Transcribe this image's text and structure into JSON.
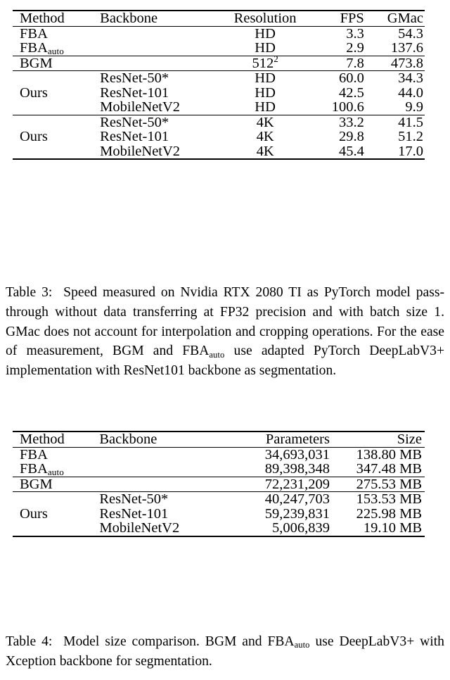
{
  "table3": {
    "columns": [
      "Method",
      "Backbone",
      "Resolution",
      "FPS",
      "GMac"
    ],
    "groups": [
      {
        "rows": [
          {
            "method": "FBA",
            "method_sub": "",
            "backbone": "",
            "resolution": "HD",
            "fps": "3.3",
            "gmac": "54.3"
          },
          {
            "method": "FBA",
            "method_sub": "auto",
            "backbone": "",
            "resolution": "HD",
            "fps": "2.9",
            "gmac": "137.6"
          }
        ]
      },
      {
        "rows": [
          {
            "method": "BGM",
            "method_sub": "",
            "backbone": "",
            "resolution": "512",
            "resolution_sup": "2",
            "fps": "7.8",
            "gmac": "473.8"
          }
        ]
      },
      {
        "group_label": "Ours",
        "rows": [
          {
            "backbone": "ResNet-50*",
            "resolution": "HD",
            "fps": "60.0",
            "gmac": "34.3"
          },
          {
            "backbone": "ResNet-101",
            "resolution": "HD",
            "fps": "42.5",
            "gmac": "44.0"
          },
          {
            "backbone": "MobileNetV2",
            "resolution": "HD",
            "fps": "100.6",
            "gmac": "9.9"
          }
        ]
      },
      {
        "group_label": "Ours",
        "rows": [
          {
            "backbone": "ResNet-50*",
            "resolution": "4K",
            "fps": "33.2",
            "gmac": "41.5"
          },
          {
            "backbone": "ResNet-101",
            "resolution": "4K",
            "fps": "29.8",
            "gmac": "51.2"
          },
          {
            "backbone": "MobileNetV2",
            "resolution": "4K",
            "fps": "45.4",
            "gmac": "17.0"
          }
        ]
      }
    ]
  },
  "caption3": {
    "label": "Table 3:",
    "part1": "Speed measured on Nvidia RTX 2080 TI as PyTorch model pass-through without data transferring at FP32 precision and with batch size 1. GMac does not account for interpolation and cropping operations. For the ease of measurement, BGM and FBA",
    "sub": "auto",
    "part2": "use adapted PyTorch DeepLabV3+ implementation with ResNet101 backbone as segmentation."
  },
  "table4": {
    "columns": [
      "Method",
      "Backbone",
      "Parameters",
      "Size"
    ],
    "groups": [
      {
        "rows": [
          {
            "method": "FBA",
            "method_sub": "",
            "backbone": "",
            "parameters": "34,693,031",
            "size": "138.80 MB"
          },
          {
            "method": "FBA",
            "method_sub": "auto",
            "backbone": "",
            "parameters": "89,398,348",
            "size": "347.48 MB"
          }
        ]
      },
      {
        "rows": [
          {
            "method": "BGM",
            "method_sub": "",
            "backbone": "",
            "parameters": "72,231,209",
            "size": "275.53 MB"
          }
        ]
      },
      {
        "group_label": "Ours",
        "rows": [
          {
            "backbone": "ResNet-50*",
            "parameters": "40,247,703",
            "size": "153.53 MB"
          },
          {
            "backbone": "ResNet-101",
            "parameters": "59,239,831",
            "size": "225.98 MB"
          },
          {
            "backbone": "MobileNetV2",
            "parameters": "5,006,839",
            "size": "19.10 MB"
          }
        ]
      }
    ]
  },
  "caption4": {
    "label": "Table 4:",
    "part1": "Model size comparison.   BGM and FBA",
    "sub": "auto",
    "part2": "use DeepLabV3+ with Xception backbone for segmentation."
  }
}
